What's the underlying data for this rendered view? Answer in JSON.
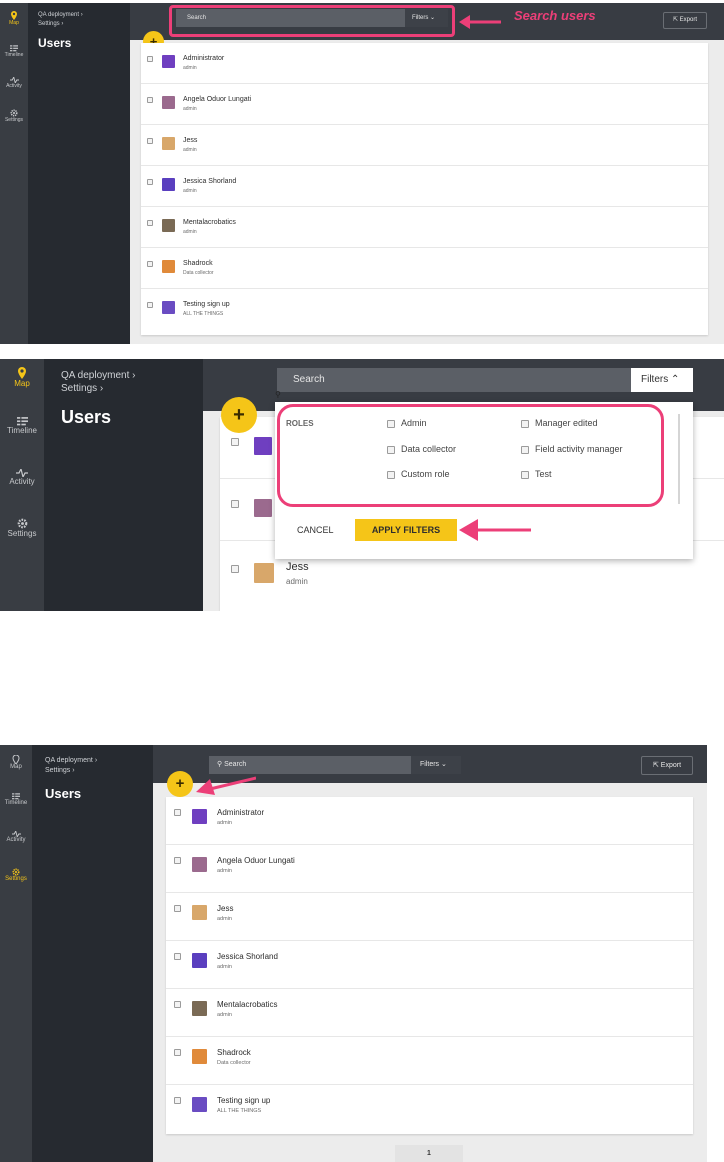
{
  "nav": {
    "map": "Map",
    "timeline": "Timeline",
    "activity": "Activity",
    "settings": "Settings"
  },
  "breadcrumb": {
    "deployment": "QA deployment",
    "settings": "Settings"
  },
  "page_title": "Users",
  "topbar": {
    "search_placeholder": "Search",
    "filters_label": "Filters",
    "export_label": "Export"
  },
  "add_button_label": "+",
  "annotations": {
    "search_users": "Search users"
  },
  "users": [
    {
      "name": "Administrator",
      "role": "admin",
      "avatar_color": "#6f3fc0"
    },
    {
      "name": "Angela Oduor Lungati",
      "role": "admin",
      "avatar_color": "#9b6a8e"
    },
    {
      "name": "Jess",
      "role": "admin",
      "avatar_color": "#d8a76a"
    },
    {
      "name": "Jessica Shorland",
      "role": "admin",
      "avatar_color": "#5a3fbf"
    },
    {
      "name": "Mentalacrobatics",
      "role": "admin",
      "avatar_color": "#7a6a55"
    },
    {
      "name": "Shadrock",
      "role": "Data collector",
      "avatar_color": "#e08a3a"
    },
    {
      "name": "Testing sign up",
      "role": "ALL THE THINGS",
      "avatar_color": "#6a4cc2"
    }
  ],
  "filter_dropdown": {
    "roles_label": "ROLES",
    "roles_col1": [
      "Admin",
      "Data collector",
      "Custom role"
    ],
    "roles_col2": [
      "Manager edited",
      "Field activity manager",
      "Test"
    ],
    "cancel_label": "CANCEL",
    "apply_label": "APPLY FILTERS"
  },
  "pagination": {
    "current_page": "1"
  },
  "colors": {
    "accent": "#f5c518",
    "highlight": "#ec3f78",
    "rail": "#393d43",
    "sidebar": "#262a30"
  }
}
